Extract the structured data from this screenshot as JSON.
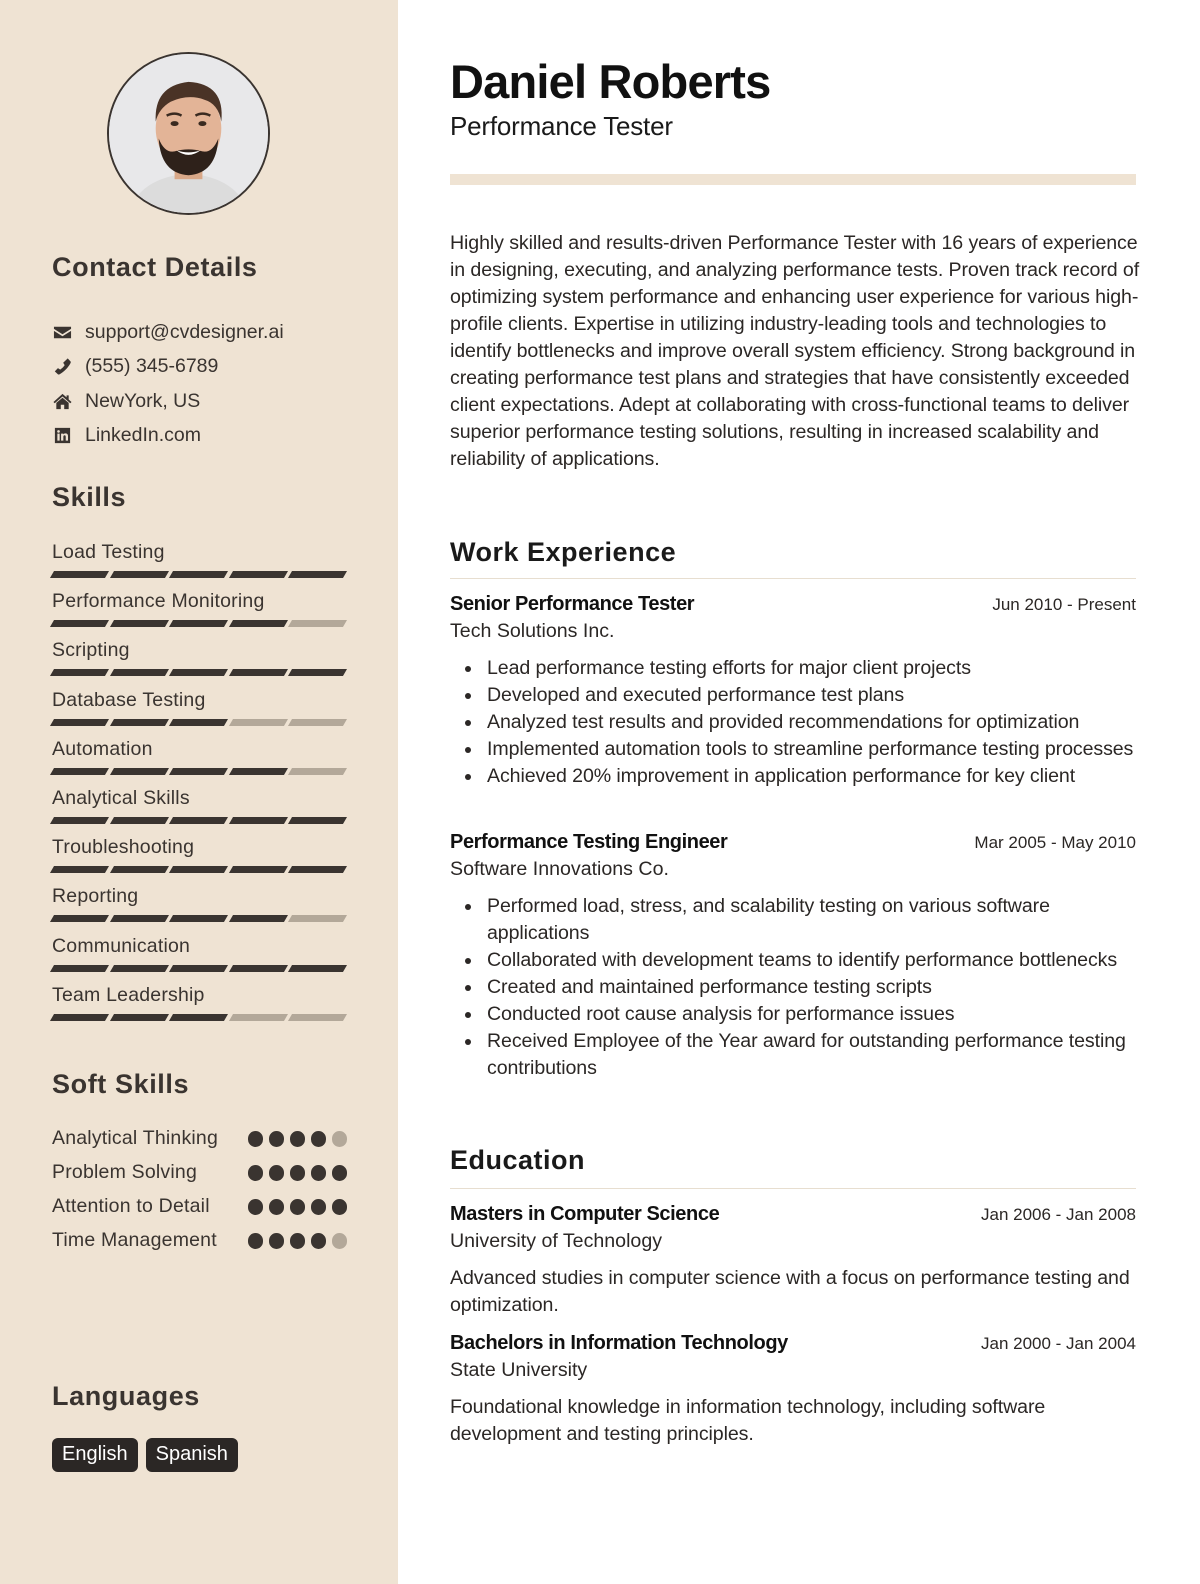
{
  "profile": {
    "name": "Daniel Roberts",
    "title": "Performance Tester",
    "photo_alt": "Profile photo of a smiling bearded man"
  },
  "contact": {
    "heading": "Contact Details",
    "items": [
      {
        "icon": "envelope-icon",
        "value": "support@cvdesigner.ai"
      },
      {
        "icon": "phone-icon",
        "value": "(555) 345-6789"
      },
      {
        "icon": "home-icon",
        "value": "NewYork, US"
      },
      {
        "icon": "linkedin-icon",
        "value": "LinkedIn.com"
      }
    ]
  },
  "skills": {
    "heading": "Skills",
    "max": 5,
    "items": [
      {
        "label": "Load Testing",
        "level": 5
      },
      {
        "label": "Performance Monitoring",
        "level": 4
      },
      {
        "label": "Scripting",
        "level": 5
      },
      {
        "label": "Database Testing",
        "level": 3
      },
      {
        "label": "Automation",
        "level": 4
      },
      {
        "label": "Analytical Skills",
        "level": 5
      },
      {
        "label": "Troubleshooting",
        "level": 5
      },
      {
        "label": "Reporting",
        "level": 4
      },
      {
        "label": "Communication",
        "level": 5
      },
      {
        "label": "Team Leadership",
        "level": 3
      }
    ]
  },
  "soft_skills": {
    "heading": "Soft Skills",
    "max": 5,
    "items": [
      {
        "label": "Analytical Thinking",
        "level": 4
      },
      {
        "label": "Problem Solving",
        "level": 5
      },
      {
        "label": "Attention to Detail",
        "level": 5
      },
      {
        "label": "Time Management",
        "level": 4
      }
    ]
  },
  "languages": {
    "heading": "Languages",
    "items": [
      "English",
      "Spanish"
    ]
  },
  "summary": "Highly skilled and results-driven Performance Tester with 16 years of experience in designing, executing, and analyzing performance tests. Proven track record of optimizing system performance and enhancing user experience for various high-profile clients. Expertise in utilizing industry-leading tools and technologies to identify bottlenecks and improve overall system efficiency. Strong background in creating performance test plans and strategies that have consistently exceeded client expectations. Adept at collaborating with cross-functional teams to deliver superior performance testing solutions, resulting in increased scalability and reliability of applications.",
  "work": {
    "heading": "Work Experience",
    "jobs": [
      {
        "title": "Senior Performance Tester",
        "dates": "Jun 2010 - Present",
        "company": "Tech Solutions Inc.",
        "bullets": [
          "Lead performance testing efforts for major client projects",
          "Developed and executed performance test plans",
          "Analyzed test results and provided recommendations for optimization",
          "Implemented automation tools to streamline performance testing processes",
          "Achieved 20% improvement in application performance for key client"
        ]
      },
      {
        "title": "Performance Testing Engineer",
        "dates": "Mar 2005 - May 2010",
        "company": "Software Innovations Co.",
        "bullets": [
          "Performed load, stress, and scalability testing on various software applications",
          "Collaborated with development teams to identify performance bottlenecks",
          "Created and maintained performance testing scripts",
          "Conducted root cause analysis for performance issues",
          "Received Employee of the Year award for outstanding performance testing contributions"
        ]
      }
    ]
  },
  "education": {
    "heading": "Education",
    "items": [
      {
        "degree": "Masters in Computer Science",
        "dates": "Jan 2006 - Jan 2008",
        "school": "University of Technology",
        "description": "Advanced studies in computer science with a focus on performance testing and optimization."
      },
      {
        "degree": "Bachelors in Information Technology",
        "dates": "Jan 2000 - Jan 2004",
        "school": "State University",
        "description": "Foundational knowledge in information technology, including software development and testing principles."
      }
    ]
  },
  "colors": {
    "sidebar_bg": "#efe3d3",
    "dark": "#3a3430",
    "muted": "#b3a899",
    "pill_bg": "#2b2725"
  }
}
